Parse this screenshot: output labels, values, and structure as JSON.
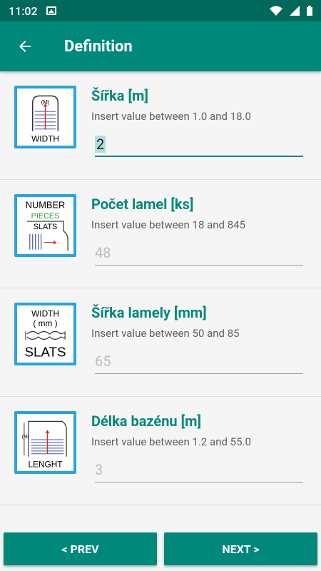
{
  "status": {
    "time": "11:02"
  },
  "appbar": {
    "title": "Definition"
  },
  "fields": [
    {
      "label": "Šířka [m]",
      "hint": "Insert value between 1.0 and 18.0",
      "value": "2",
      "icon_text": [
        "(M)",
        "WIDTH"
      ]
    },
    {
      "label": "Počet lamel [ks]",
      "hint": "Insert value between 18 and 845",
      "value": "48",
      "icon_text": [
        "NUMBER",
        "PIECES",
        "SLATS"
      ]
    },
    {
      "label": "Šířka lamely [mm]",
      "hint": "Insert value between 50 and 85",
      "value": "65",
      "icon_text": [
        "WIDTH",
        "( mm )",
        "SLATS"
      ]
    },
    {
      "label": "Délka bazénu [m]",
      "hint": "Insert value between 1.2 and 55.0",
      "value": "3",
      "icon_text": [
        "(M)",
        "LENGHT"
      ]
    }
  ],
  "footer": {
    "prev_label": "< PREV",
    "next_label": "NEXT >"
  },
  "colors": {
    "primary": "#00897b",
    "primary_dark": "#00695c",
    "icon_border": "#29a3e0"
  }
}
